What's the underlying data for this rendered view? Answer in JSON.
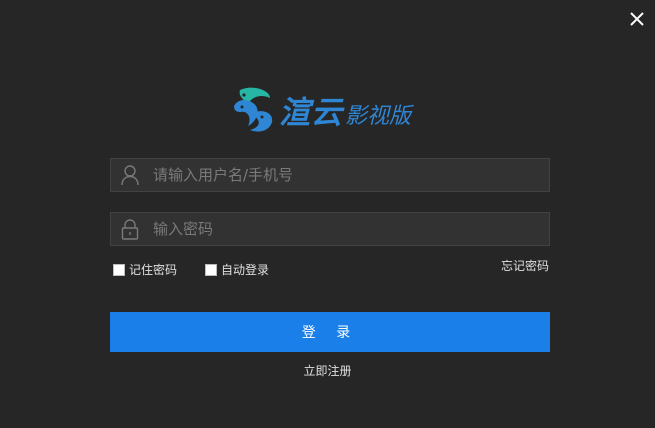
{
  "app": {
    "brand_main": "渲云",
    "brand_sub": "影视版"
  },
  "form": {
    "username_placeholder": "请输入用户名/手机号",
    "password_placeholder": "输入密码",
    "remember_label": "记住密码",
    "auto_login_label": "自动登录",
    "forgot_label": "忘记密码",
    "login_label": "登 录",
    "register_label": "立即注册"
  },
  "icons": {
    "close": "close-icon",
    "user": "user-icon",
    "lock": "lock-icon",
    "logo": "fish-logo-icon"
  },
  "colors": {
    "background": "#262626",
    "accent": "#1a7fe8",
    "brand": "#2f86d4",
    "logo_teal": "#27b6a6"
  }
}
